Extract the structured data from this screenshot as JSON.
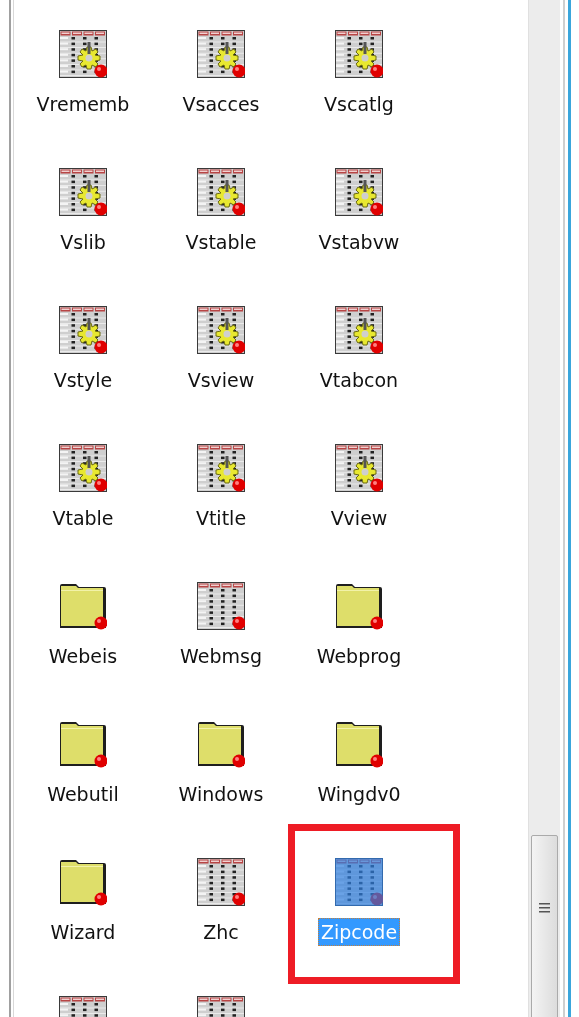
{
  "items": [
    {
      "kind": "table-view",
      "label": "Vrememb",
      "selected": false,
      "highlighted": false
    },
    {
      "kind": "table-view",
      "label": "Vsacces",
      "selected": false,
      "highlighted": false
    },
    {
      "kind": "table-view",
      "label": "Vscatlg",
      "selected": false,
      "highlighted": false
    },
    {
      "kind": "table-view",
      "label": "Vslib",
      "selected": false,
      "highlighted": false
    },
    {
      "kind": "table-view",
      "label": "Vstable",
      "selected": false,
      "highlighted": false
    },
    {
      "kind": "table-view",
      "label": "Vstabvw",
      "selected": false,
      "highlighted": false
    },
    {
      "kind": "table-view",
      "label": "Vstyle",
      "selected": false,
      "highlighted": false
    },
    {
      "kind": "table-view",
      "label": "Vsview",
      "selected": false,
      "highlighted": false
    },
    {
      "kind": "table-view",
      "label": "Vtabcon",
      "selected": false,
      "highlighted": false
    },
    {
      "kind": "table-view",
      "label": "Vtable",
      "selected": false,
      "highlighted": false
    },
    {
      "kind": "table-view",
      "label": "Vtitle",
      "selected": false,
      "highlighted": false
    },
    {
      "kind": "table-view",
      "label": "Vview",
      "selected": false,
      "highlighted": false
    },
    {
      "kind": "folder",
      "label": "Webeis",
      "selected": false,
      "highlighted": false
    },
    {
      "kind": "table",
      "label": "Webmsg",
      "selected": false,
      "highlighted": false
    },
    {
      "kind": "folder",
      "label": "Webprog",
      "selected": false,
      "highlighted": false
    },
    {
      "kind": "folder",
      "label": "Webutil",
      "selected": false,
      "highlighted": false
    },
    {
      "kind": "folder",
      "label": "Windows",
      "selected": false,
      "highlighted": false
    },
    {
      "kind": "folder",
      "label": "Wingdv0",
      "selected": false,
      "highlighted": false
    },
    {
      "kind": "folder",
      "label": "Wizard",
      "selected": false,
      "highlighted": false
    },
    {
      "kind": "table",
      "label": "Zhc",
      "selected": false,
      "highlighted": false
    },
    {
      "kind": "table",
      "label": "Zipcode",
      "selected": true,
      "highlighted": true
    },
    {
      "kind": "table",
      "selected": false,
      "highlighted": false
    },
    {
      "kind": "table",
      "selected": false,
      "highlighted": false
    }
  ]
}
